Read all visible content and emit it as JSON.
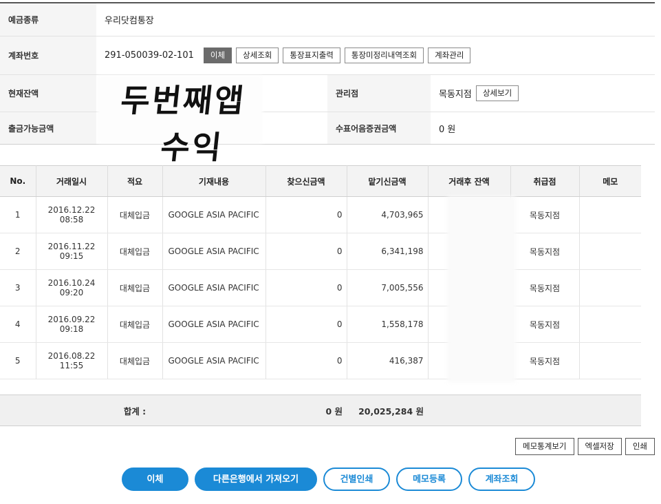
{
  "account": {
    "type_label": "예금종류",
    "type_value": "우리닷컴통장",
    "number_label": "계좌번호",
    "number_value": "291-050039-02-101",
    "number_buttons": [
      "이체",
      "상세조회",
      "통장표지출력",
      "통장미정리내역조회",
      "계좌관리"
    ],
    "balance_label": "현재잔액",
    "branch_label": "관리점",
    "branch_value": "목동지점",
    "branch_button": "상세보기",
    "withdrawable_label": "출금가능금액",
    "check_label": "수표어음증권금액",
    "check_value": "0 원"
  },
  "overlay": {
    "line1": "두번째앱",
    "line2": "수익"
  },
  "table": {
    "headers": [
      "No.",
      "거래일시",
      "적요",
      "기재내용",
      "찾으신금액",
      "맡기신금액",
      "거래후 잔액",
      "취급점",
      "메모"
    ],
    "rows": [
      {
        "no": "1",
        "date": "2016.12.22 08:58",
        "memo_type": "대체입금",
        "desc": "GOOGLE ASIA PACIFIC",
        "withdraw": "0",
        "deposit": "4,703,965",
        "branch": "목동지점"
      },
      {
        "no": "2",
        "date": "2016.11.22 09:15",
        "memo_type": "대체입금",
        "desc": "GOOGLE ASIA PACIFIC",
        "withdraw": "0",
        "deposit": "6,341,198",
        "branch": "목동지점"
      },
      {
        "no": "3",
        "date": "2016.10.24 09:20",
        "memo_type": "대체입금",
        "desc": "GOOGLE ASIA PACIFIC",
        "withdraw": "0",
        "deposit": "7,005,556",
        "branch": "목동지점"
      },
      {
        "no": "4",
        "date": "2016.09.22 09:18",
        "memo_type": "대체입금",
        "desc": "GOOGLE ASIA PACIFIC",
        "withdraw": "0",
        "deposit": "1,558,178",
        "branch": "목동지점"
      },
      {
        "no": "5",
        "date": "2016.08.22 11:55",
        "memo_type": "대체입금",
        "desc": "GOOGLE ASIA PACIFIC",
        "withdraw": "0",
        "deposit": "416,387",
        "branch": "목동지점"
      }
    ],
    "total_label": "합계 :",
    "total_withdraw": "0 원",
    "total_deposit": "20,025,284 원"
  },
  "mini_buttons": [
    "메모통계보기",
    "엑셀저장",
    "인쇄"
  ],
  "big_buttons": [
    "이체",
    "다른은행에서 가져오기",
    "건별인쇄",
    "메모등록",
    "계좌조회"
  ],
  "colors": {
    "accent": "#1b8ad6",
    "dark_button": "#6b6b6b",
    "header_bg": "#f3f3f3"
  }
}
